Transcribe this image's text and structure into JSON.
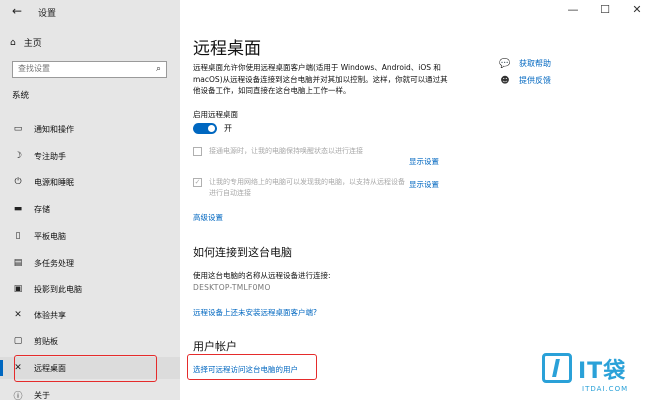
{
  "window": {
    "title": "设置",
    "back_icon": "back-arrow-icon",
    "controls": [
      "—",
      "☐",
      "✕"
    ]
  },
  "sidebar": {
    "home": {
      "icon": "home-icon",
      "label": "主页"
    },
    "search": {
      "placeholder": "查找设置",
      "icon": "search-icon"
    },
    "section": "系统",
    "items": [
      {
        "icon": "notification-icon",
        "label": "通知和操作"
      },
      {
        "icon": "focus-assist-icon",
        "label": "专注助手"
      },
      {
        "icon": "power-icon",
        "label": "电源和睡眠"
      },
      {
        "icon": "storage-icon",
        "label": "存储"
      },
      {
        "icon": "tablet-icon",
        "label": "平板电脑"
      },
      {
        "icon": "multitasking-icon",
        "label": "多任务处理"
      },
      {
        "icon": "projecting-icon",
        "label": "投影到此电脑"
      },
      {
        "icon": "shared-experiences-icon",
        "label": "体验共享"
      },
      {
        "icon": "clipboard-icon",
        "label": "剪贴板"
      },
      {
        "icon": "remote-desktop-icon",
        "label": "远程桌面"
      },
      {
        "icon": "info-icon",
        "label": "关于"
      }
    ],
    "active_index": 9
  },
  "main": {
    "title": "远程桌面",
    "description": "远程桌面允许你使用远程桌面客户端(适用于 Windows、Android、iOS 和 macOS)从远程设备连接到这台电脑并对其加以控制。这样，你就可以通过其他设备工作，如同直接在这台电脑上工作一样。",
    "enable_label": "启用远程桌面",
    "toggle_state": "开",
    "toggle_on": true,
    "checkbox1_text": "接通电源时，让我的电脑保持唤醒状态以进行连接",
    "checkbox1_checked": false,
    "checkbox2_text": "让我的专用网络上的电脑可以发现我的电脑，以支持从远程设备进行自动连接",
    "checkbox2_checked": true,
    "show_settings_1": "显示设置",
    "show_settings_2": "显示设置",
    "advanced_settings": "高级设置",
    "how_to_connect_heading": "如何连接到这台电脑",
    "use_name_text": "使用这台电脑的名称从远程设备进行连接:",
    "pc_name": "DESKTOP-TMLF0MO",
    "no_client_link": "远程设备上还未安装远程桌面客户端?",
    "user_accounts_heading": "用户帐户",
    "select_users_link": "选择可远程访问这台电脑的用户"
  },
  "help": {
    "get_help": {
      "icon": "help-chat-icon",
      "label": "获取帮助"
    },
    "feedback": {
      "icon": "feedback-icon",
      "label": "提供反馈"
    }
  },
  "watermark": {
    "text": "IT袋",
    "sub": "ITDAI.COM"
  },
  "colors": {
    "accent": "#0067c0",
    "highlight_box": "#e52b2b",
    "sidebar_bg": "#e6e6e6"
  }
}
